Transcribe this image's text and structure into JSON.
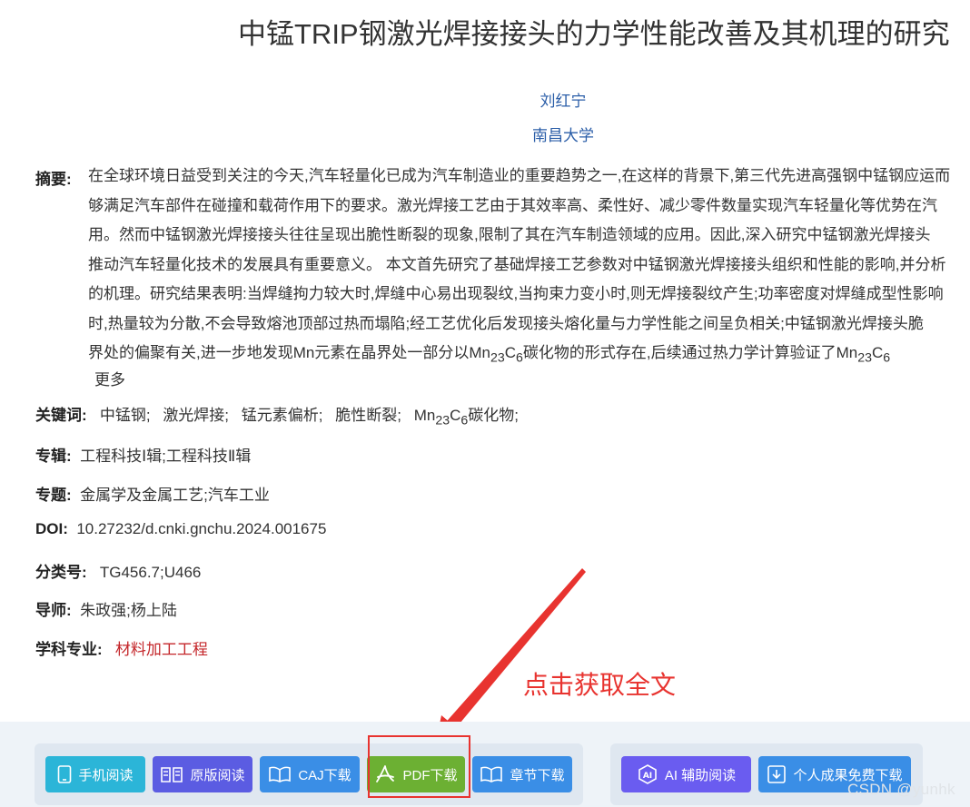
{
  "title": "中锰TRIP钢激光焊接接头的力学性能改善及其机理的研究",
  "author": "刘红宁",
  "org": "南昌大学",
  "abstract": {
    "label": "摘要:",
    "lines": [
      "在全球环境日益受到关注的今天,汽车轻量化已成为汽车制造业的重要趋势之一,在这样的背景下,第三代先进高强钢中锰钢应运而",
      "够满足汽车部件在碰撞和载荷作用下的要求。激光焊接工艺由于其效率高、柔性好、减少零件数量实现汽车轻量化等优势在汽",
      "用。然而中锰钢激光焊接接头往往呈现出脆性断裂的现象,限制了其在汽车制造领域的应用。因此,深入研究中锰钢激光焊接头",
      "推动汽车轻量化技术的发展具有重要意义。 本文首先研究了基础焊接工艺参数对中锰钢激光焊接接头组织和性能的影响,并分析",
      "的机理。研究结果表明:当焊缝拘力较大时,焊缝中心易出现裂纹,当拘束力变小时,则无焊接裂纹产生;功率密度对焊缝成型性影响",
      "时,热量较为分散,不会导致熔池顶部过热而塌陷;经工艺优化后发现接头熔化量与力学性能之间呈负相关;中锰钢激光焊接头脆"
    ],
    "last_line": {
      "a": "界处的偏聚有关,进一步地发现Mn元素在晶界处一部分以Mn",
      "b": "C",
      "c": "碳化物的形式存在,后续通过热力学计算验证了Mn",
      "d": "C",
      "sub23": "23",
      "sub6": "6"
    },
    "more": "更多"
  },
  "keywords": {
    "label": "关键词:",
    "items": [
      "中锰钢;",
      "激光焊接;",
      "锰元素偏析;",
      "脆性断裂;"
    ],
    "last": {
      "a": "Mn",
      "b": "C",
      "c": "碳化物;",
      "sub23": "23",
      "sub6": "6"
    }
  },
  "album": {
    "label": "专辑:",
    "value": "工程科技Ⅰ辑;工程科技Ⅱ辑"
  },
  "topic": {
    "label": "专题:",
    "value": "金属学及金属工艺;汽车工业"
  },
  "doi": {
    "label": "DOI:",
    "value": "10.27232/d.cnki.gnchu.2024.001675"
  },
  "classno": {
    "label": "分类号:",
    "value": "TG456.7;U466"
  },
  "advisor": {
    "label": "导师:",
    "value": "朱政强;杨上陆"
  },
  "major": {
    "label": "学科专业:",
    "value": "材料加工工程"
  },
  "annotation": "点击获取全文",
  "buttons": {
    "mobile": "手机阅读",
    "original": "原版阅读",
    "caj": "CAJ下载",
    "pdf": "PDF下载",
    "chapter": "章节下载",
    "ai": "AI 辅助阅读",
    "personal": "个人成果免费下载"
  },
  "colors": {
    "mobile": "#2bb5d8",
    "original": "#5b5ce2",
    "caj": "#3a8ee6",
    "pdf": "#6cb033",
    "chapter": "#3a8ee6",
    "ai": "#6a5cf0",
    "personal": "#3a8ee6",
    "annotation": "#e8332f"
  },
  "watermark": "CSDN @yunhk"
}
